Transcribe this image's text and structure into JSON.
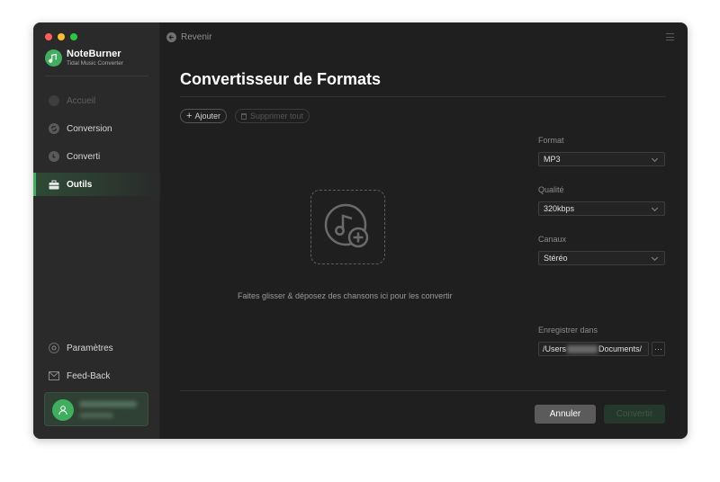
{
  "app": {
    "name": "NoteBurner",
    "subtitle": "Tidal Music Converter",
    "traffic_lights": [
      "#ff5f57",
      "#febc2e",
      "#28c840"
    ],
    "accent_color": "#3fae5d"
  },
  "sidebar": {
    "items": [
      {
        "label": "Accueil",
        "icon": "home-icon",
        "state": "disabled"
      },
      {
        "label": "Conversion",
        "icon": "sync-icon",
        "state": "normal"
      },
      {
        "label": "Converti",
        "icon": "clock-icon",
        "state": "normal"
      },
      {
        "label": "Outils",
        "icon": "toolbox-icon",
        "state": "active"
      }
    ],
    "bottom_items": [
      {
        "label": "Paramètres",
        "icon": "gear-icon"
      },
      {
        "label": "Feed-Back",
        "icon": "mail-icon"
      }
    ]
  },
  "topbar": {
    "back_label": "Revenir"
  },
  "main": {
    "title": "Convertisseur de Formats",
    "add_button": "Ajouter",
    "delete_all_button": "Supprimer tout",
    "drop_text": "Faites glisser & déposez des chansons ici pour les convertir"
  },
  "settings": {
    "format_label": "Format",
    "format_value": "MP3",
    "quality_label": "Qualité",
    "quality_value": "320kbps",
    "channels_label": "Canaux",
    "channels_value": "Stéréo",
    "save_label": "Enregistrer dans",
    "save_path_prefix": "/Users",
    "save_path_suffix": "Documents/",
    "browse_label": "···"
  },
  "actions": {
    "cancel": "Annuler",
    "convert": "Convertir"
  }
}
